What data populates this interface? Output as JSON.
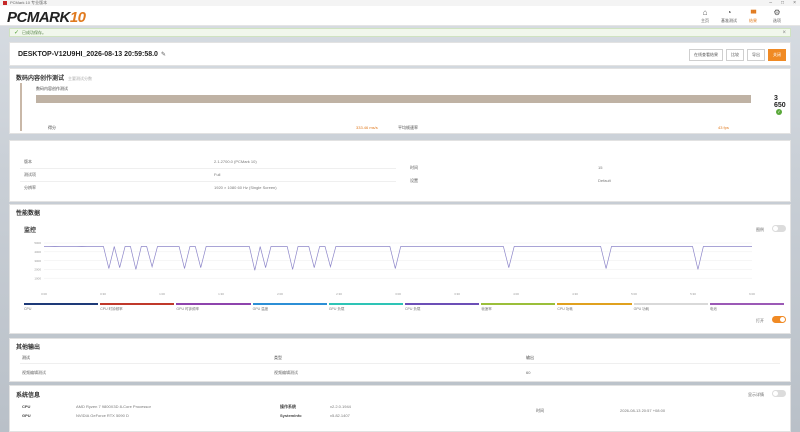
{
  "window": {
    "title": "PCMark 10 专业版本"
  },
  "header": {
    "brand_main": "PCMARK",
    "brand_num": "10",
    "nav": [
      {
        "icon": "home-icon",
        "glyph": "⌂",
        "label": "主页"
      },
      {
        "icon": "benchmark-icon",
        "glyph": "◔",
        "label": "基准测试"
      },
      {
        "icon": "results-icon",
        "glyph": "▮▮▮",
        "label": "结果"
      },
      {
        "icon": "options-icon",
        "glyph": "⚙",
        "label": "选项"
      }
    ]
  },
  "notice": {
    "text": "已成功保存。"
  },
  "result": {
    "title": "DESKTOP-V12U9HI_2026-08-13 20:59:58.0",
    "buttons": [
      "在线查看结果",
      "比较",
      "导出",
      "关闭"
    ]
  },
  "score": {
    "section_title": "数码内容创作测试",
    "section_sub": "主要测试分数",
    "name": "数码内容创作测试",
    "value": "3 650",
    "bar_fraction": 1.0,
    "metrics": [
      {
        "label": "得分",
        "value": "333.46 ms/s"
      },
      {
        "label": "平均帧速率",
        "value": "43 fps"
      }
    ]
  },
  "info": {
    "rows": [
      {
        "k1": "版本",
        "v1": "2.1.2700.0 (PCMark 10)",
        "k2": "时间",
        "v2": "15"
      },
      {
        "k1": "测试项",
        "v1": "Full",
        "k2": "设置",
        "v2": "Default"
      },
      {
        "k1": "分辨率",
        "v1": "1920 × 1080 60 Hz (Single Screen)",
        "k2": "",
        "v2": ""
      }
    ]
  },
  "perf": {
    "title": "性能数据",
    "monitor_title": "监控",
    "toggle_label": "图例",
    "toggle2_label": "打开",
    "legend": [
      {
        "label": "CPU",
        "color": "#1e3a78"
      },
      {
        "label": "CPU 时钟频率",
        "color": "#c0392b"
      },
      {
        "label": "GPU 时钟频率",
        "color": "#8e44ad"
      },
      {
        "label": "GPU 温度",
        "color": "#2c8fd6"
      },
      {
        "label": "GPU 负载",
        "color": "#2ec4b6"
      },
      {
        "label": "CPU 负载",
        "color": "#6c4fb7"
      },
      {
        "label": "帧速率",
        "color": "#9bbf3a"
      },
      {
        "label": "CPU 功耗",
        "color": "#e0a11f"
      },
      {
        "label": "GPU 功耗",
        "color": "#d9d9d9"
      },
      {
        "label": "电池",
        "color": "#9b59b6"
      }
    ]
  },
  "chart_data": {
    "type": "line",
    "ylim": [
      0,
      5000
    ],
    "yticks": [
      "5000",
      "4000",
      "3000",
      "2000",
      "1000"
    ],
    "xticks": [
      "0:00",
      "0:30",
      "1:00",
      "1:30",
      "2:00",
      "2:30",
      "3:00",
      "3:30",
      "4:00",
      "4:30",
      "5:00",
      "5:30",
      "6:00"
    ],
    "series": [
      {
        "color": "#8d86c9",
        "values": [
          4600,
          4600,
          4620,
          4600,
          4610,
          4600,
          4600,
          4620,
          4600,
          4610,
          4600,
          4600,
          2100,
          4600,
          2200,
          4600,
          4600,
          2000,
          4600,
          4600,
          2300,
          4600,
          4600,
          4600,
          4600,
          4600,
          2100,
          4600,
          4600,
          2200,
          4600,
          4600,
          4600,
          4600,
          4600,
          4600,
          4600,
          4600,
          4600,
          1900,
          4600,
          2200,
          4600,
          4600,
          4600,
          4600,
          2000,
          4600,
          4600,
          4600,
          2200,
          4600,
          4600,
          2300,
          4600,
          4600,
          4600,
          4600,
          4600,
          4600,
          4600,
          4600,
          4600,
          4600,
          4600,
          2100,
          4600,
          4600,
          4600,
          4600,
          4600,
          4600,
          4600,
          4600,
          4600,
          4600,
          4600,
          4600,
          4600,
          4600,
          4600,
          4600,
          4600,
          4600,
          4600,
          4600,
          2200,
          4600,
          4600,
          4600,
          4600,
          4600,
          4600,
          4600,
          4600,
          4600,
          4600,
          4600,
          4600,
          4600,
          4600,
          4600,
          4600,
          4600,
          2100,
          4600,
          4600,
          4600,
          4600,
          4600,
          4600,
          4600,
          4600,
          4600,
          4600,
          4600,
          4600,
          4600,
          4600,
          4600,
          4600,
          2000,
          4600,
          4600,
          4600,
          4600,
          4600,
          4600,
          4600,
          4600,
          4600,
          4600
        ]
      }
    ]
  },
  "other": {
    "title": "其他输出",
    "headers": [
      "测试",
      "类型",
      "输出"
    ],
    "row": [
      "视频编辑测试",
      "视频编辑测试",
      "60"
    ]
  },
  "system": {
    "title": "系统信息",
    "toggle_label": "显示详情",
    "rows": [
      {
        "k": "CPU",
        "v": "AMD Ryzen 7 9800X3D 8-Core Processor",
        "k2": "操作系统",
        "v2": "v2.2.0.1944",
        "k3": "时间",
        "v3": "2026-08-13 20:57 +08:00"
      },
      {
        "k": "GPU",
        "v": "NVIDIA GeForce RTX 5090 D",
        "k2": "SystemInfo",
        "v2": "v5.82.1407",
        "k3": "",
        "v3": ""
      }
    ]
  }
}
